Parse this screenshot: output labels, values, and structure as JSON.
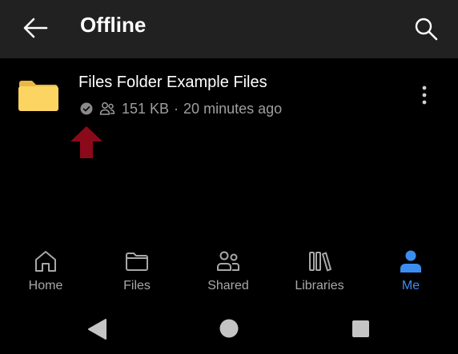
{
  "appbar": {
    "title": "Offline"
  },
  "file": {
    "name": "Files Folder Example Files",
    "size": "151 KB",
    "separator": "·",
    "modified": "20 minutes ago"
  },
  "bottom_nav": {
    "items": [
      {
        "label": "Home",
        "icon": "home-icon",
        "active": false
      },
      {
        "label": "Files",
        "icon": "folder-icon",
        "active": false
      },
      {
        "label": "Shared",
        "icon": "people-icon",
        "active": false
      },
      {
        "label": "Libraries",
        "icon": "libraries-icon",
        "active": false
      },
      {
        "label": "Me",
        "icon": "person-icon",
        "active": true
      }
    ]
  },
  "colors": {
    "accent": "#3b8ef0",
    "folder": "#fcd462",
    "annotation_arrow": "#8b0a1a",
    "appbar": "#212121"
  }
}
